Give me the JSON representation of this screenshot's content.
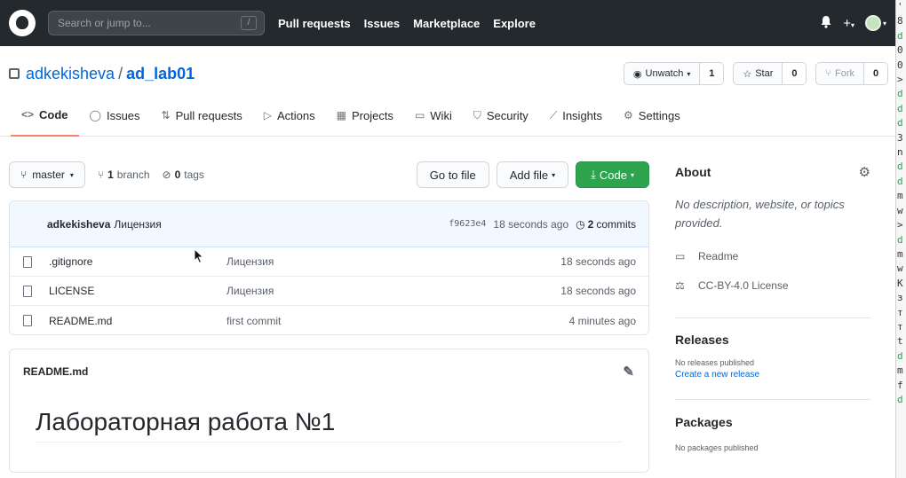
{
  "header": {
    "search_placeholder": "Search or jump to...",
    "search_shortcut": "/",
    "nav": [
      "Pull requests",
      "Issues",
      "Marketplace",
      "Explore"
    ],
    "plus": "+",
    "caret": "▾"
  },
  "repo": {
    "owner": "adkekisheva",
    "separator": "/",
    "name": "ad_lab01",
    "watch_label": "Unwatch",
    "watch_count": "1",
    "star_label": "Star",
    "star_count": "0",
    "fork_label": "Fork",
    "fork_count": "0"
  },
  "tabs": [
    {
      "icon": "<>",
      "label": "Code"
    },
    {
      "icon": "◯",
      "label": "Issues"
    },
    {
      "icon": "⇅",
      "label": "Pull requests"
    },
    {
      "icon": "▷",
      "label": "Actions"
    },
    {
      "icon": "▦",
      "label": "Projects"
    },
    {
      "icon": "▭",
      "label": "Wiki"
    },
    {
      "icon": "⛉",
      "label": "Security"
    },
    {
      "icon": "⟋",
      "label": "Insights"
    },
    {
      "icon": "⚙",
      "label": "Settings"
    }
  ],
  "toolbar": {
    "branch": "master",
    "branch_count": "1",
    "branch_word": "branch",
    "tag_count": "0",
    "tag_word": "tags",
    "go_to_file": "Go to file",
    "add_file": "Add file",
    "code": "Code"
  },
  "commit": {
    "author": "adkekisheva",
    "message": "Лицензия",
    "sha": "f9623e4",
    "time": "18 seconds ago",
    "commits_count": "2",
    "commits_word": "commits"
  },
  "files": [
    {
      "name": ".gitignore",
      "message": "Лицензия",
      "age": "18 seconds ago"
    },
    {
      "name": "LICENSE",
      "message": "Лицензия",
      "age": "18 seconds ago"
    },
    {
      "name": "README.md",
      "message": "first commit",
      "age": "4 minutes ago"
    }
  ],
  "readme": {
    "filename": "README.md",
    "heading": "Лабораторная работа №1"
  },
  "sidebar": {
    "about_title": "About",
    "about_desc": "No description, website, or topics provided.",
    "readme_link": "Readme",
    "license_link": "CC-BY-4.0 License",
    "releases_title": "Releases",
    "releases_none": "No releases published",
    "releases_create": "Create a new release",
    "packages_title": "Packages",
    "packages_none": "No packages published"
  },
  "terminal_chars": [
    "'",
    "8",
    "d",
    "0",
    "0",
    ">",
    "d",
    "d",
    "d",
    "3",
    "n",
    "d",
    "d",
    "m",
    "w",
    ">",
    "d",
    "m",
    "w",
    "K",
    "з",
    "т",
    "т",
    "t",
    "d",
    "m",
    "f",
    "d"
  ],
  "colors": {
    "accent": "#f9826c",
    "green": "#2ea44f",
    "link": "#0366d6"
  }
}
